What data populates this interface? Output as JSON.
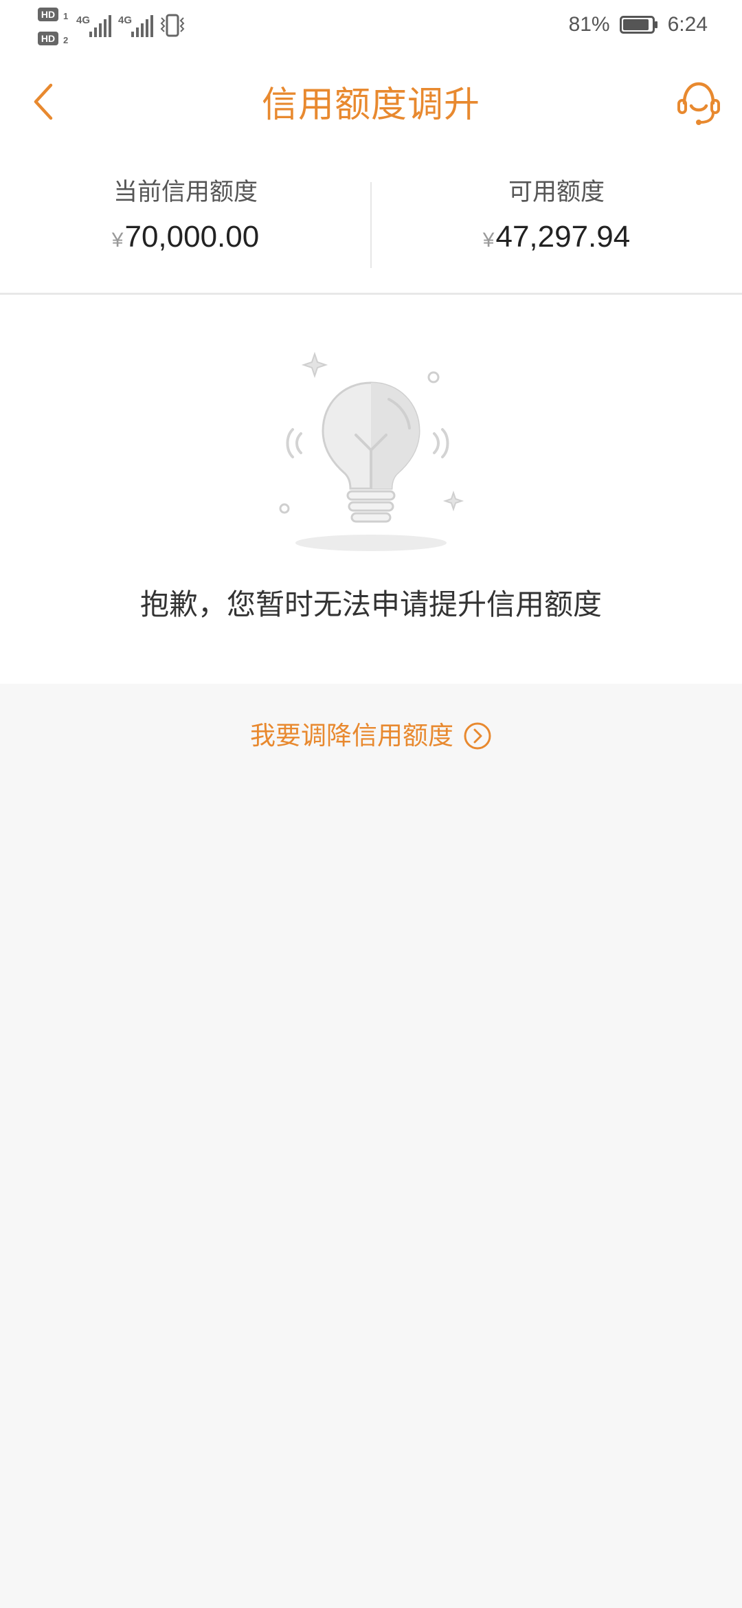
{
  "status_bar": {
    "left_badges": [
      "HD",
      "HD"
    ],
    "left_badge_nums": [
      "1",
      "2"
    ],
    "network": [
      "4G",
      "4G"
    ],
    "battery_percent": "81%",
    "time": "6:24"
  },
  "header": {
    "title": "信用额度调升",
    "back_icon": "chevron-left-icon",
    "service_icon": "customer-service-headset-icon"
  },
  "summary": {
    "current_label": "当前信用额度",
    "current_currency": "¥",
    "current_amount": "70,000.00",
    "available_label": "可用额度",
    "available_currency": "¥",
    "available_amount": "47,297.94"
  },
  "illustration": {
    "icon": "lightbulb-icon"
  },
  "message": "抱歉，您暂时无法申请提升信用额度",
  "lower_link": {
    "label": "我要调降信用额度",
    "icon": "circle-chevron-right-icon"
  },
  "colors": {
    "accent": "#e8892f",
    "background": "#f7f7f7"
  }
}
